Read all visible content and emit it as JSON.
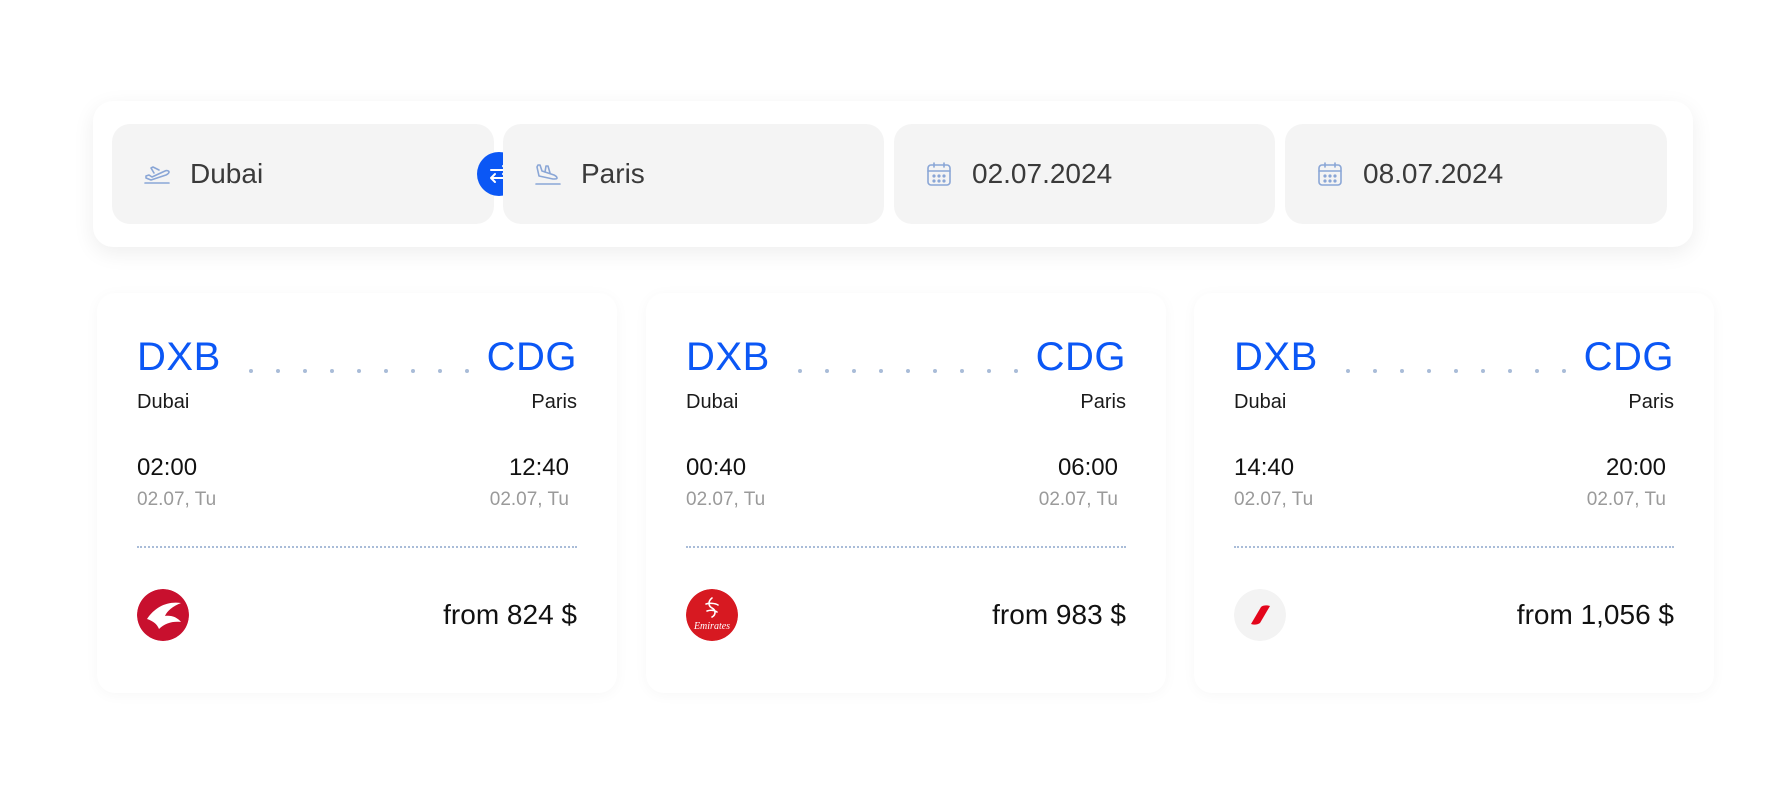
{
  "search": {
    "origin": {
      "icon": "plane-takeoff-icon",
      "value": "Dubai"
    },
    "destination": {
      "icon": "plane-landing-icon",
      "value": "Paris"
    },
    "depart": {
      "icon": "calendar-icon",
      "value": "02.07.2024"
    },
    "return": {
      "icon": "calendar-icon",
      "value": "08.07.2024"
    },
    "swap_icon": "swap-arrows-icon"
  },
  "colors": {
    "accent": "#0b57f5",
    "field_bg": "#f4f4f4",
    "muted": "#9a9a9a",
    "dots": "#a9bcd8",
    "turkish_red": "#c8102e",
    "emirates_red": "#d71921",
    "airfrance_red": "#e3051b"
  },
  "flights": [
    {
      "from_code": "DXB",
      "from_city": "Dubai",
      "to_code": "CDG",
      "to_city": "Paris",
      "dep_time": "02:00",
      "dep_date": "02.07, Tu",
      "arr_time": "12:40",
      "arr_date": "02.07, Tu",
      "airline_logo": "turkish-airlines-logo",
      "price": "from 824 $"
    },
    {
      "from_code": "DXB",
      "from_city": "Dubai",
      "to_code": "CDG",
      "to_city": "Paris",
      "dep_time": "00:40",
      "dep_date": "02.07, Tu",
      "arr_time": "06:00",
      "arr_date": "02.07, Tu",
      "airline_logo": "emirates-logo",
      "airline_logo_text": "Emirates",
      "price": "from 983 $"
    },
    {
      "from_code": "DXB",
      "from_city": "Dubai",
      "to_code": "CDG",
      "to_city": "Paris",
      "dep_time": "14:40",
      "dep_date": "02.07, Tu",
      "arr_time": "20:00",
      "arr_date": "02.07, Tu",
      "airline_logo": "air-france-logo",
      "price": "from 1,056 $"
    }
  ]
}
